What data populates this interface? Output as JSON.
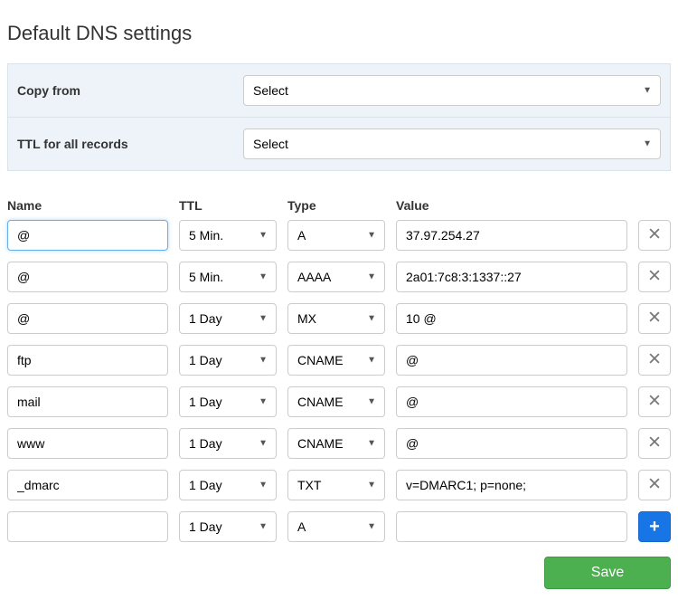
{
  "page": {
    "title": "Default DNS settings"
  },
  "topPanel": {
    "copy_from_label": "Copy from",
    "copy_from_value": "Select",
    "ttl_all_label": "TTL for all records",
    "ttl_all_value": "Select"
  },
  "headers": {
    "name": "Name",
    "ttl": "TTL",
    "type": "Type",
    "value": "Value"
  },
  "records": [
    {
      "name": "@",
      "ttl": "5 Min.",
      "type": "A",
      "value": "37.97.254.27",
      "action": "remove",
      "focused": true
    },
    {
      "name": "@",
      "ttl": "5 Min.",
      "type": "AAAA",
      "value": "2a01:7c8:3:1337::27",
      "action": "remove"
    },
    {
      "name": "@",
      "ttl": "1 Day",
      "type": "MX",
      "value": "10 @",
      "action": "remove"
    },
    {
      "name": "ftp",
      "ttl": "1 Day",
      "type": "CNAME",
      "value": "@",
      "action": "remove"
    },
    {
      "name": "mail",
      "ttl": "1 Day",
      "type": "CNAME",
      "value": "@",
      "action": "remove"
    },
    {
      "name": "www",
      "ttl": "1 Day",
      "type": "CNAME",
      "value": "@",
      "action": "remove"
    },
    {
      "name": "_dmarc",
      "ttl": "1 Day",
      "type": "TXT",
      "value": "v=DMARC1; p=none;",
      "action": "remove"
    },
    {
      "name": "",
      "ttl": "1 Day",
      "type": "A",
      "value": "",
      "action": "add"
    }
  ],
  "footer": {
    "save_label": "Save"
  }
}
